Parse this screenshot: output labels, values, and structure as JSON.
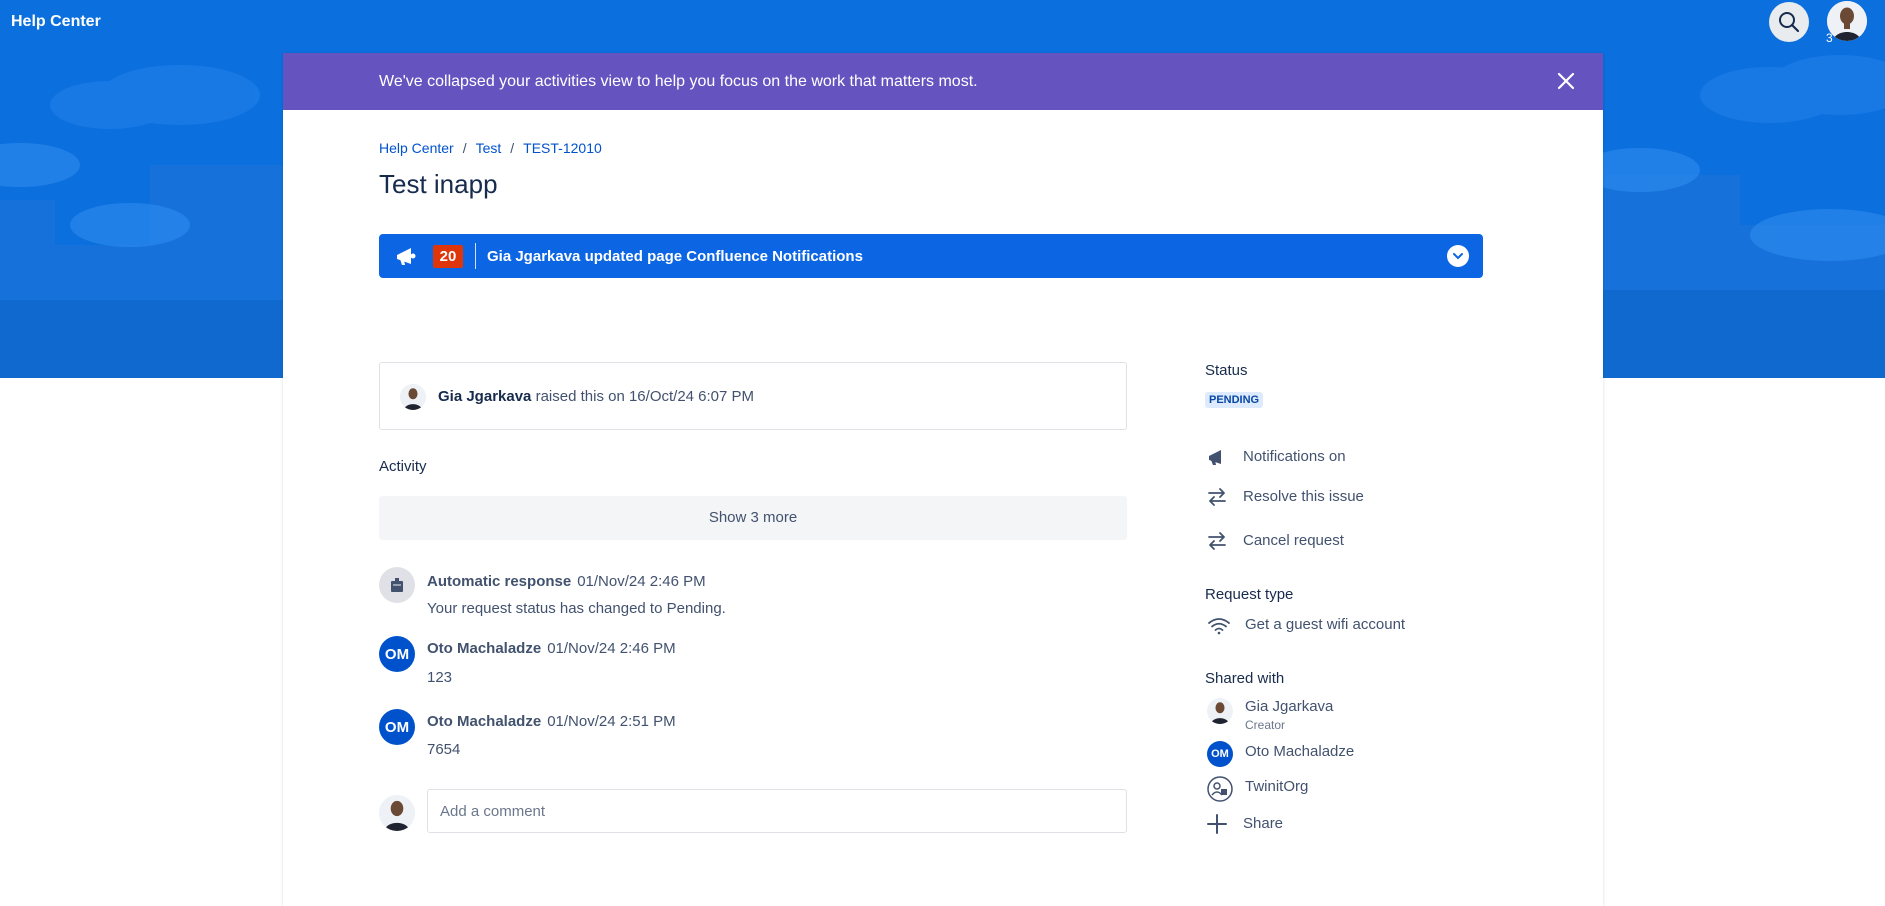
{
  "topbar": {
    "brand": "Help Center",
    "profile_badge": "3"
  },
  "banner": {
    "message": "We've collapsed your activities view to help you focus on the work that matters most."
  },
  "breadcrumb": [
    "Help Center",
    "Test",
    "TEST-12010"
  ],
  "page_title": "Test inapp",
  "notification": {
    "count": "20",
    "text": "Gia Jgarkava updated page Confluence Notifications"
  },
  "raised": {
    "name": "Gia Jgarkava",
    "text": "raised this on 16/Oct/24 6:07 PM"
  },
  "activity": {
    "heading": "Activity",
    "show_more": "Show 3 more",
    "items": [
      {
        "author": "Automatic response",
        "time": "01/Nov/24 2:46 PM",
        "body": "Your request status has changed to Pending."
      },
      {
        "initials": "OM",
        "author": "Oto Machaladze",
        "time": "01/Nov/24 2:46 PM",
        "body": "123"
      },
      {
        "initials": "OM",
        "author": "Oto Machaladze",
        "time": "01/Nov/24 2:51 PM",
        "body": "7654"
      }
    ]
  },
  "comment": {
    "placeholder": "Add a comment"
  },
  "sidebar": {
    "status_heading": "Status",
    "status_value": "PENDING",
    "actions": [
      "Notifications on",
      "Resolve this issue",
      "Cancel request"
    ],
    "request_type_heading": "Request type",
    "request_type": "Get a guest wifi account",
    "shared_heading": "Shared with",
    "shared": [
      {
        "name": "Gia Jgarkava",
        "role": "Creator"
      },
      {
        "initials": "OM",
        "name": "Oto Machaladze"
      },
      {
        "name": "TwinitOrg"
      }
    ],
    "share_label": "Share"
  },
  "colors": {
    "hero_blue": "#0b6fde",
    "banner_purple": "#6554c0",
    "notif_blue": "#0c66e4",
    "count_red": "#de350b",
    "om_blue": "#0052cc"
  }
}
